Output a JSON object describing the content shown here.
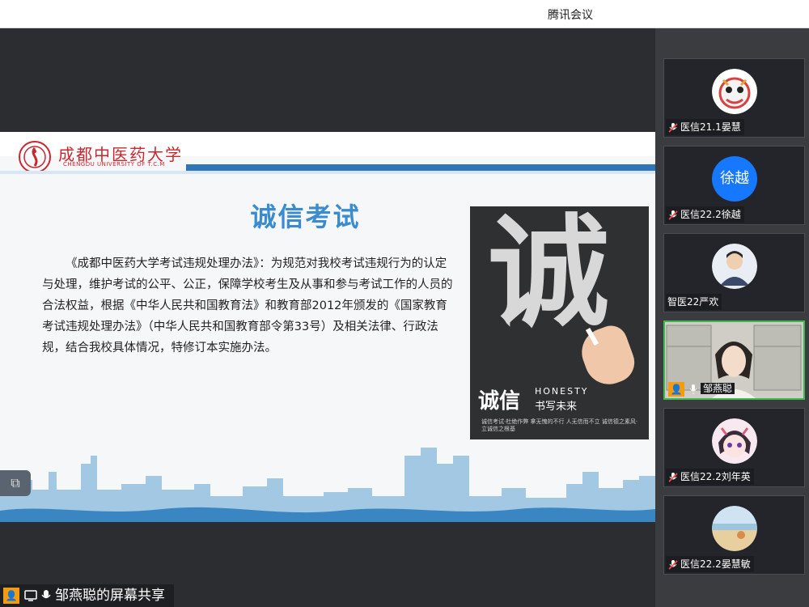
{
  "window": {
    "title": "腾讯会议"
  },
  "slide": {
    "university_name": "成都中医药大学",
    "university_sub": "CHENGDU UNIVERSITY OF T.C.M",
    "heading": "诚信考试",
    "body": "《成都中医药大学考试违规处理办法》：为规范对我校考试违规行为的认定与处理，维护考试的公平、公正，保障学校考生及从事和参与考试工作的人员的合法权益，根据《中华人民共和国教育法》和教育部2012年颁发的《国家教育考试违规处理办法》（中华人民共和国教育部令第33号）及相关法律、行政法规，结合我校具体情况，特修订本实施办法。",
    "photo": {
      "big_char": "诚",
      "caption_main": "诚信",
      "caption_en": "HONESTY",
      "caption_sub": "书写未来",
      "caption_small": "诚信考试·杜绝作弊 拿无愧的不行 人无信而不立 诚信德之素风·立诚信之根基"
    },
    "nav_icon": "slide-nav-icon"
  },
  "participants": [
    {
      "name": "医信21.1晏慧",
      "muted": true,
      "avatar": "lion-dance-avatar"
    },
    {
      "name": "医信22.2徐越",
      "muted": true,
      "avatar_text": "徐越",
      "avatar_color": "#1677ff"
    },
    {
      "name": "智医22严欢",
      "muted": false,
      "avatar": "photo-avatar"
    },
    {
      "name": "邹燕聪",
      "muted": false,
      "speaking": true,
      "avatar": "video-feed"
    },
    {
      "name": "医信22.2刘年英",
      "muted": true,
      "avatar": "anime-avatar"
    },
    {
      "name": "医信22.2晏慧敏",
      "muted": true,
      "avatar": "beach-avatar"
    }
  ],
  "share_bar": {
    "label": "邹燕聪的屏幕共享"
  },
  "colors": {
    "accent_blue": "#3a8bd0",
    "brand_red": "#c8272f",
    "active_border": "#3fb950"
  }
}
